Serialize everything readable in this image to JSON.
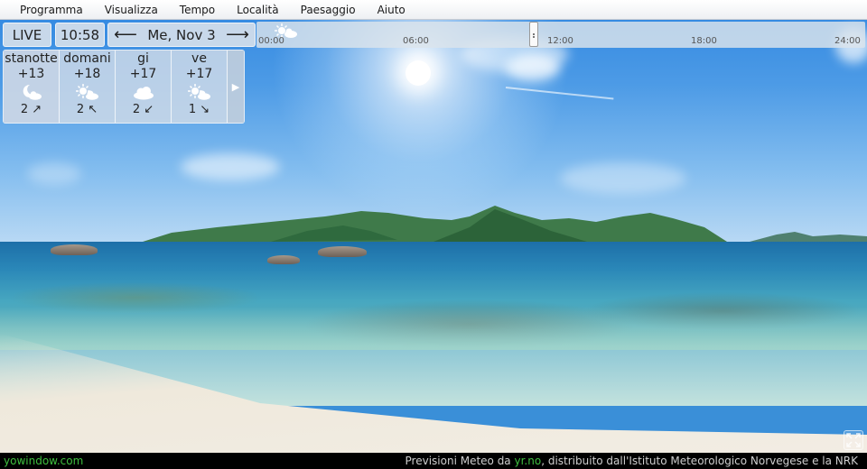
{
  "menu": [
    "Programma",
    "Visualizza",
    "Tempo",
    "Località",
    "Paesaggio",
    "Aiuto"
  ],
  "toolbar": {
    "live": "LIVE",
    "time": "10:58",
    "prev_arrow": "⟵",
    "date": "Me, Nov 3",
    "next_arrow": "⟶"
  },
  "timeline": {
    "ticks": [
      "00:00",
      "06:00",
      "12:00",
      "18:00",
      "24:00"
    ],
    "current_time": "10:58",
    "icon": "sun-cloud-icon"
  },
  "forecast": [
    {
      "name": "stanotte",
      "temp": "+13",
      "icon": "moon-cloud-icon",
      "wind": "2",
      "wind_dir": "↗"
    },
    {
      "name": "domani",
      "temp": "+18",
      "icon": "sun-cloud-icon",
      "wind": "2",
      "wind_dir": "↖"
    },
    {
      "name": "gi",
      "temp": "+17",
      "icon": "cloud-icon",
      "wind": "2",
      "wind_dir": "↙"
    },
    {
      "name": "ve",
      "temp": "+17",
      "icon": "sun-cloud-icon",
      "wind": "1",
      "wind_dir": "↘"
    }
  ],
  "forecast_more": "▶",
  "footer": {
    "brand": "yowindow.com",
    "credit_prefix": "Previsioni Meteo da",
    "credit_link": "yr.no",
    "credit_suffix": ", distribuito dall'Istituto Meteorologico Norvegese e la NRK"
  },
  "colors": {
    "footer_link": "#3fbf3f",
    "sky": "#2f86e0",
    "sea": "#1d6fa8"
  }
}
